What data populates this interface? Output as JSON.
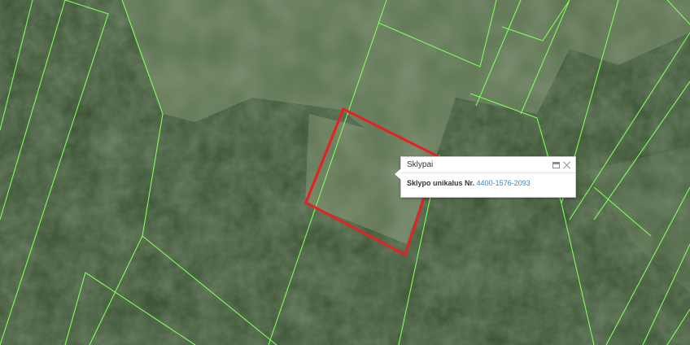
{
  "map": {
    "layer": "satellite",
    "colors": {
      "parcel_boundary": "#7cff5a",
      "selected_parcel": "#e02424",
      "link": "#3a86c8"
    }
  },
  "popup": {
    "title": "Sklypai",
    "field_label": "Sklypo unikalus Nr.",
    "parcel_number": "4400-1576-2093",
    "icons": [
      "maximize-icon",
      "close-icon"
    ]
  }
}
